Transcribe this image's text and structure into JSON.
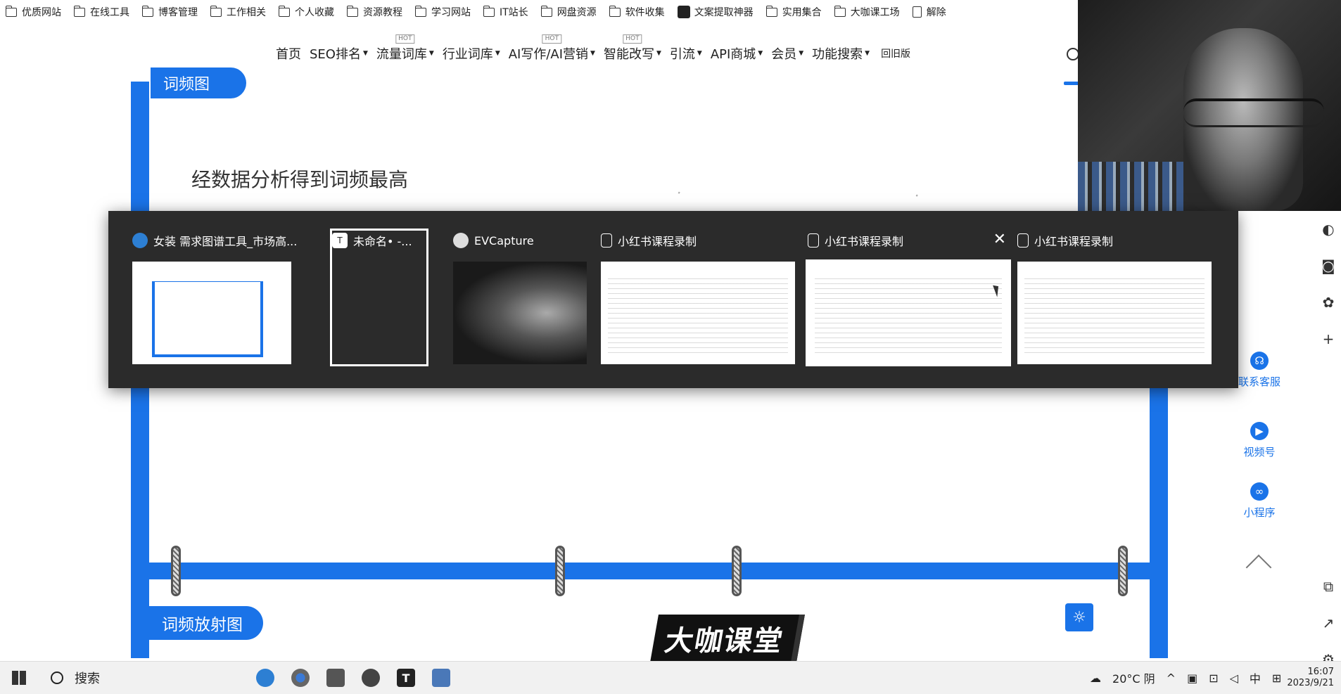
{
  "bookmarks": [
    {
      "label": "优质网站",
      "icon": "folder-icon"
    },
    {
      "label": "在线工具",
      "icon": "folder-icon"
    },
    {
      "label": "博客管理",
      "icon": "folder-icon"
    },
    {
      "label": "工作相关",
      "icon": "folder-icon"
    },
    {
      "label": "个人收藏",
      "icon": "folder-icon"
    },
    {
      "label": "资源教程",
      "icon": "folder-icon"
    },
    {
      "label": "学习网站",
      "icon": "folder-icon"
    },
    {
      "label": "IT站长",
      "icon": "folder-icon"
    },
    {
      "label": "网盘资源",
      "icon": "folder-icon"
    },
    {
      "label": "软件收集",
      "icon": "folder-icon"
    },
    {
      "label": "文案提取神器",
      "icon": "app-icon"
    },
    {
      "label": "实用集合",
      "icon": "folder-icon"
    },
    {
      "label": "大咖课工场",
      "icon": "folder-icon"
    },
    {
      "label": "解除",
      "icon": "document-icon"
    }
  ],
  "nav": {
    "items": [
      {
        "label": "首页",
        "caret": false,
        "hot": ""
      },
      {
        "label": "SEO排名",
        "caret": true,
        "hot": ""
      },
      {
        "label": "流量词库",
        "caret": true,
        "hot": "HOT"
      },
      {
        "label": "行业词库",
        "caret": true,
        "hot": ""
      },
      {
        "label": "AI写作/AI营销",
        "caret": true,
        "hot": "HOT"
      },
      {
        "label": "智能改写",
        "caret": true,
        "hot": "HOT"
      },
      {
        "label": "引流",
        "caret": true,
        "hot": ""
      },
      {
        "label": "API商城",
        "caret": true,
        "hot": ""
      },
      {
        "label": "会员",
        "caret": true,
        "hot": ""
      },
      {
        "label": "功能搜索",
        "caret": true,
        "hot": ""
      }
    ],
    "old_version": "回旧版"
  },
  "page": {
    "heading": "经数据分析得到词频最高",
    "section_tag_top": "词频图",
    "section_tag_bottom": "词频放射图",
    "logo_text": "大咖课堂"
  },
  "task_switcher": {
    "windows": [
      {
        "title": "女装 需求图谱工具_市场高...",
        "icon": "edge-beta-icon",
        "thumb": "web"
      },
      {
        "title": "未命名• -...",
        "icon": "typora-icon",
        "thumb": "dark",
        "selected_outline": true
      },
      {
        "title": "EVCapture",
        "icon": "evcapture-icon",
        "thumb": "camera"
      },
      {
        "title": "小红书课程录制",
        "icon": "document-icon",
        "thumb": "doc"
      },
      {
        "title": "小红书课程录制",
        "icon": "document-icon",
        "thumb": "doc",
        "selected": true
      },
      {
        "title": "小红书课程录制",
        "icon": "document-icon",
        "thumb": "doc"
      }
    ]
  },
  "right_panel": {
    "items": [
      {
        "label": "联系客服",
        "icon": "headset-icon"
      },
      {
        "label": "视频号",
        "icon": "video-icon"
      },
      {
        "label": "小程序",
        "icon": "mini-program-icon"
      }
    ]
  },
  "taskbar": {
    "search_label": "搜索",
    "weather": "20°C 阴",
    "ime": "中",
    "time": "16:07",
    "date": "2023/9/21"
  },
  "colors": {
    "accent": "#1a73e8",
    "switcher_bg": "#2b2b2b"
  }
}
